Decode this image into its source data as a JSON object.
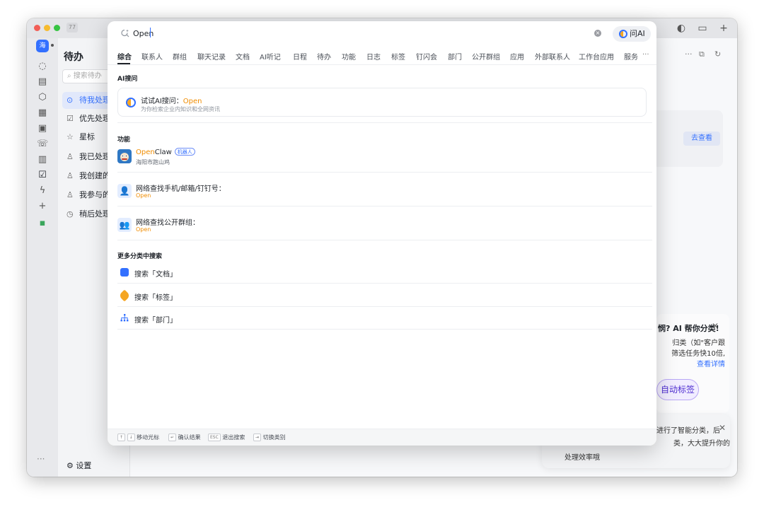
{
  "titlebar": {
    "badge": "77"
  },
  "rail": {
    "avatar": "海"
  },
  "panel": {
    "title": "待办",
    "search_placeholder": "搜索待办",
    "items": [
      {
        "label": "待我处理",
        "icon": "check-circle-icon"
      },
      {
        "label": "优先处理",
        "icon": "check-square-icon"
      },
      {
        "label": "星标",
        "icon": "star-icon"
      },
      {
        "label": "我已处理",
        "icon": "person-check-icon"
      },
      {
        "label": "我创建的",
        "icon": "person-icon"
      },
      {
        "label": "我参与的",
        "icon": "person-icon"
      },
      {
        "label": "稍后处理",
        "icon": "clock-icon"
      }
    ],
    "settings": "设置"
  },
  "background": {
    "view_button": "去查看",
    "promo_title": "悯? AI 帮你分类!",
    "promo_line1": "归类（如\"客户跟",
    "promo_line2": "筛选任务快10倍,",
    "promo_link": "查看详情",
    "promo_button": "自动标签",
    "toast_line1": "进行了智能分类，后",
    "toast_line2": "类，大大提升你的",
    "toast_line3": "处理效率哦"
  },
  "search": {
    "query": "Open",
    "ask_ai_label": "问AI"
  },
  "tabs": [
    "综合",
    "联系人",
    "群组",
    "聊天记录",
    "文档",
    "AI听记",
    "日程",
    "待办",
    "功能",
    "日志",
    "标签",
    "钉闪会",
    "部门",
    "公开群组",
    "应用",
    "外部联系人",
    "工作台应用",
    "服务"
  ],
  "sections": {
    "ai": "AI搜问",
    "features": "功能",
    "more": "更多分类中搜索"
  },
  "ai_card": {
    "prefix": "试试AI搜问：",
    "keyword": "Open",
    "subtitle": "为你检索企业内知识和全网资讯"
  },
  "results": [
    {
      "kw": "Open",
      "rest": "Claw",
      "badge": "机器人",
      "subtitle": "海阳市跑山鸡"
    },
    {
      "title": "网络查找手机/邮箱/钉钉号：",
      "subtitle": "Open"
    },
    {
      "title": "网络查找公开群组：",
      "subtitle": "Open"
    }
  ],
  "more_categories": [
    {
      "label": "搜索「文档」",
      "icon": "doc-icon",
      "color": "#3370ff"
    },
    {
      "label": "搜索「标签」",
      "icon": "tag-icon",
      "color": "#f5a623"
    },
    {
      "label": "搜索「部门」",
      "icon": "org-icon",
      "color": "#3370ff"
    }
  ],
  "footer": {
    "move": "移动光标",
    "confirm": "确认结果",
    "exit_key": "ESC",
    "exit": "退出搜索",
    "switch": "切换类别"
  },
  "colors": {
    "accent": "#3370ff",
    "keyword": "#f08c00"
  }
}
